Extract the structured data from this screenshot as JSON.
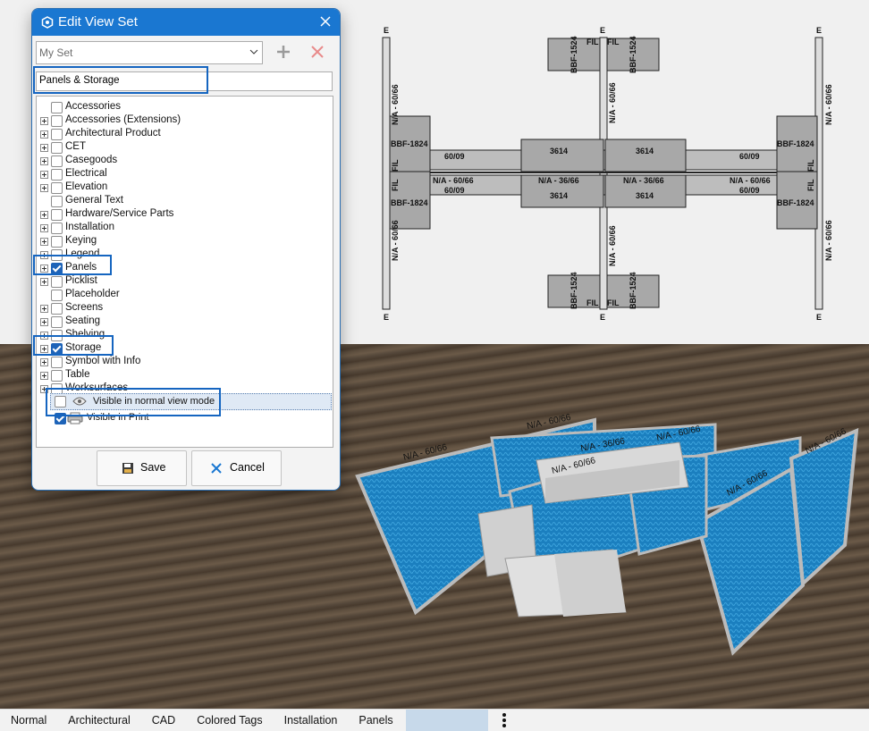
{
  "dialog": {
    "title": "Edit View Set",
    "set_selected": "My Set",
    "filter_value": "Panels & Storage",
    "tree_items": [
      {
        "label": "Accessories",
        "expandable": false,
        "checked": false
      },
      {
        "label": "Accessories (Extensions)",
        "expandable": true,
        "checked": false
      },
      {
        "label": "Architectural Product",
        "expandable": true,
        "checked": false
      },
      {
        "label": "CET",
        "expandable": true,
        "checked": false
      },
      {
        "label": "Casegoods",
        "expandable": true,
        "checked": false
      },
      {
        "label": "Electrical",
        "expandable": true,
        "checked": false
      },
      {
        "label": "Elevation",
        "expandable": true,
        "checked": false
      },
      {
        "label": "General Text",
        "expandable": false,
        "checked": false
      },
      {
        "label": "Hardware/Service Parts",
        "expandable": true,
        "checked": false
      },
      {
        "label": "Installation",
        "expandable": true,
        "checked": false
      },
      {
        "label": "Keying",
        "expandable": true,
        "checked": false
      },
      {
        "label": "Legend",
        "expandable": true,
        "checked": false
      },
      {
        "label": "Panels",
        "expandable": true,
        "checked": true
      },
      {
        "label": "Picklist",
        "expandable": true,
        "checked": false
      },
      {
        "label": "Placeholder",
        "expandable": false,
        "checked": false
      },
      {
        "label": "Screens",
        "expandable": true,
        "checked": false
      },
      {
        "label": "Seating",
        "expandable": true,
        "checked": false
      },
      {
        "label": "Shelving",
        "expandable": true,
        "checked": false
      },
      {
        "label": "Storage",
        "expandable": true,
        "checked": true
      },
      {
        "label": "Symbol with Info",
        "expandable": true,
        "checked": false
      },
      {
        "label": "Table",
        "expandable": true,
        "checked": false
      },
      {
        "label": "Worksurfaces",
        "expandable": true,
        "checked": false
      }
    ],
    "visible_normal_label": "Visible in normal view mode",
    "visible_print_label": "Visible in Print",
    "save_label": "Save",
    "cancel_label": "Cancel"
  },
  "plan": {
    "labels": {
      "e": "E",
      "fil": "FIL",
      "bbf": "BBF-1824",
      "bbf_small": "BBF-1524",
      "na_6066": "N/A - 60/66",
      "na_3666": "N/A - 36/66",
      "p6009": "60/09",
      "p3614": "3614"
    }
  },
  "view3d": {
    "labels": {
      "na_6066": "N/A - 60/66",
      "na_3666": "N/A - 36/66"
    }
  },
  "tabs": [
    "Normal",
    "Architectural",
    "CAD",
    "Colored Tags",
    "Installation",
    "Panels"
  ],
  "colors": {
    "accent": "#1a77d1",
    "highlight_border": "#1565c0",
    "panel_fabric": "#1b7fbf",
    "floor": "#5a4a3a"
  }
}
